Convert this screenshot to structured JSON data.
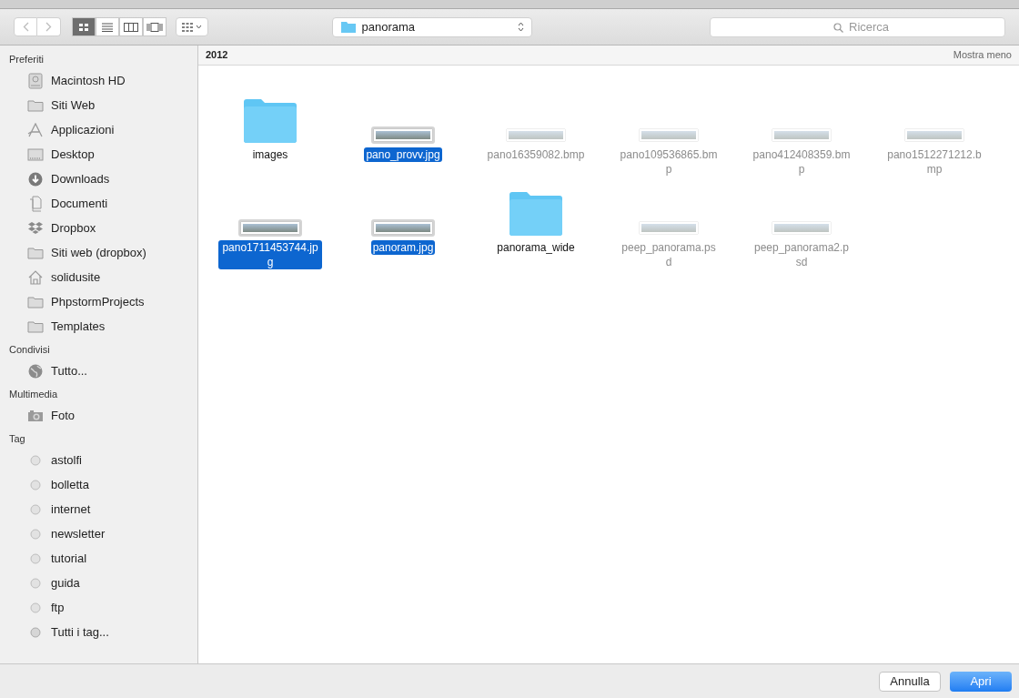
{
  "toolbar": {
    "view_modes": [
      {
        "kind": "icons",
        "selected": true
      },
      {
        "kind": "list",
        "selected": false
      },
      {
        "kind": "columns",
        "selected": false
      },
      {
        "kind": "coverflow",
        "selected": false
      }
    ],
    "location": "panorama",
    "search": {
      "placeholder": "Ricerca"
    }
  },
  "sidebar": [
    {
      "title": "Preferiti",
      "items": [
        {
          "kind": "disk",
          "label": "Macintosh HD"
        },
        {
          "kind": "folder",
          "label": "Siti Web"
        },
        {
          "kind": "apps",
          "label": "Applicazioni"
        },
        {
          "kind": "desktop",
          "label": "Desktop"
        },
        {
          "kind": "download",
          "label": "Downloads"
        },
        {
          "kind": "document",
          "label": "Documenti"
        },
        {
          "kind": "dropbox",
          "label": "Dropbox"
        },
        {
          "kind": "folder",
          "label": "Siti web (dropbox)"
        },
        {
          "kind": "home",
          "label": "solidusite"
        },
        {
          "kind": "folder",
          "label": "PhpstormProjects"
        },
        {
          "kind": "folder",
          "label": "Templates"
        }
      ]
    },
    {
      "title": "Condivisi",
      "items": [
        {
          "kind": "network",
          "label": "Tutto..."
        }
      ]
    },
    {
      "title": "Multimedia",
      "items": [
        {
          "kind": "camera",
          "label": "Foto"
        }
      ]
    },
    {
      "title": "Tag",
      "items": [
        {
          "kind": "tag",
          "label": "astolfi"
        },
        {
          "kind": "tag",
          "label": "bolletta"
        },
        {
          "kind": "tag",
          "label": "internet"
        },
        {
          "kind": "tag",
          "label": "newsletter"
        },
        {
          "kind": "tag",
          "label": "tutorial"
        },
        {
          "kind": "tag",
          "label": "guida"
        },
        {
          "kind": "tag",
          "label": "ftp"
        },
        {
          "kind": "alltags",
          "label": "Tutti i tag..."
        }
      ]
    }
  ],
  "section": {
    "title": "2012",
    "toggle": "Mostra meno"
  },
  "files": [
    {
      "kind": "folder",
      "name": "images",
      "selected": false,
      "disabled": false
    },
    {
      "kind": "image",
      "name": "pano_provv.jpg",
      "selected": true,
      "disabled": false
    },
    {
      "kind": "image",
      "name": "pano16359082.bmp",
      "selected": false,
      "disabled": true
    },
    {
      "kind": "image",
      "name": "pano109536865.bmp",
      "selected": false,
      "disabled": true
    },
    {
      "kind": "image",
      "name": "pano412408359.bmp",
      "selected": false,
      "disabled": true
    },
    {
      "kind": "image",
      "name": "pano1512271212.bmp",
      "selected": false,
      "disabled": true
    },
    {
      "kind": "image",
      "name": "pano1711453744.jpg",
      "selected": true,
      "disabled": false
    },
    {
      "kind": "image",
      "name": "panoram.jpg",
      "selected": true,
      "disabled": false
    },
    {
      "kind": "folder",
      "name": "panorama_wide",
      "selected": false,
      "disabled": false
    },
    {
      "kind": "image",
      "name": "peep_panorama.psd",
      "selected": false,
      "disabled": true
    },
    {
      "kind": "image",
      "name": "peep_panorama2.psd",
      "selected": false,
      "disabled": true
    }
  ],
  "buttons": [
    {
      "kind": "secondary",
      "label": "Annulla"
    },
    {
      "kind": "primary",
      "label": "Apri"
    }
  ]
}
